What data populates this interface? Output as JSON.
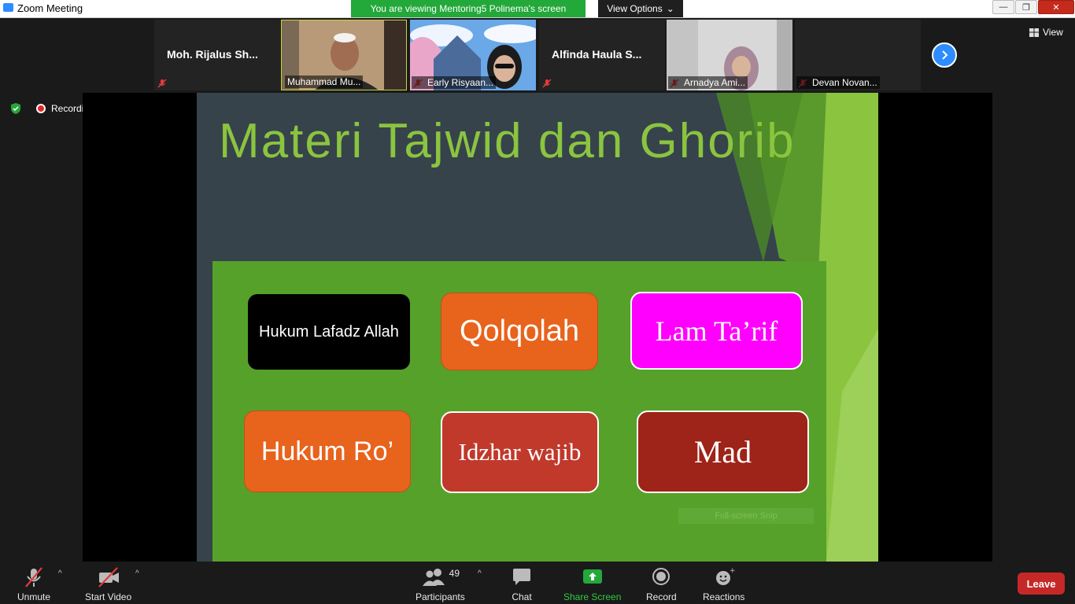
{
  "window": {
    "title": "Zoom Meeting"
  },
  "banner": {
    "viewing_text": "You are viewing Mentoring5 Polinema's screen",
    "view_options_label": "View Options"
  },
  "participants_strip": [
    {
      "name": "Moh. Rijalus Sh...",
      "video": false,
      "muted": true
    },
    {
      "name": "Muhammad Mu...",
      "video": true,
      "muted": false,
      "active": true
    },
    {
      "name": "Early Risyaan...",
      "video": true,
      "muted": true
    },
    {
      "name": "Alfinda Haula S...",
      "video": false,
      "muted": true
    },
    {
      "name": "Arnadya Ami...",
      "video": true,
      "muted": true
    },
    {
      "name": "Devan Novan...",
      "video": false,
      "muted": true
    }
  ],
  "view_button": {
    "label": "View"
  },
  "status": {
    "recording_label": "Recording"
  },
  "slide": {
    "title": "Materi Tajwid dan Ghorib",
    "cards": [
      {
        "label": "Hukum Lafadz Allah",
        "bg": "#000000"
      },
      {
        "label": "Qolqolah",
        "bg": "#e8631c"
      },
      {
        "label": "Lam Ta’rif",
        "bg": "#ff00ff"
      },
      {
        "label": "Hukum Ro’",
        "bg": "#e8631c"
      },
      {
        "label": "Idzhar wajib",
        "bg": "#c0392b"
      },
      {
        "label": "Mad",
        "bg": "#9e2318"
      }
    ],
    "snip_label": "Full-screen Snip"
  },
  "toolbar": {
    "unmute": "Unmute",
    "start_video": "Start Video",
    "participants": "Participants",
    "participants_count": "49",
    "chat": "Chat",
    "share_screen": "Share Screen",
    "record": "Record",
    "reactions": "Reactions",
    "leave": "Leave"
  },
  "colors": {
    "accent": "#2d8cff",
    "share_green": "#23a83a",
    "leave_red": "#c62828",
    "slide_green": "#56a12a"
  }
}
